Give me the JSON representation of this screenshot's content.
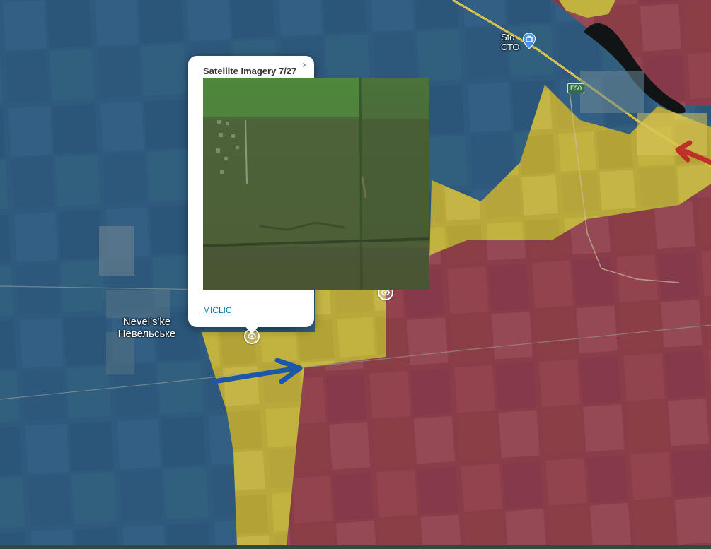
{
  "map": {
    "colors": {
      "ukraine_control": "#2f5f86",
      "contested": "#c9b43a",
      "russia_control": "#8f3f4a",
      "ukraine_arrow": "#1b58a8",
      "russia_arrow": "#c0302a",
      "road": "#f2d649",
      "water": "#101414"
    },
    "labels": {
      "town_latin": "Nevel's'ke",
      "town_cyrillic": "Невельське",
      "sto_latin": "Sto",
      "sto_cyrillic": "СТО",
      "road_ref": "E50"
    },
    "icons": [
      "poi-eye-icon",
      "shop-icon",
      "close-icon"
    ]
  },
  "popup": {
    "title": "Satellite Imagery 7/27",
    "close_label": "×",
    "link_label": "MICLIC"
  }
}
